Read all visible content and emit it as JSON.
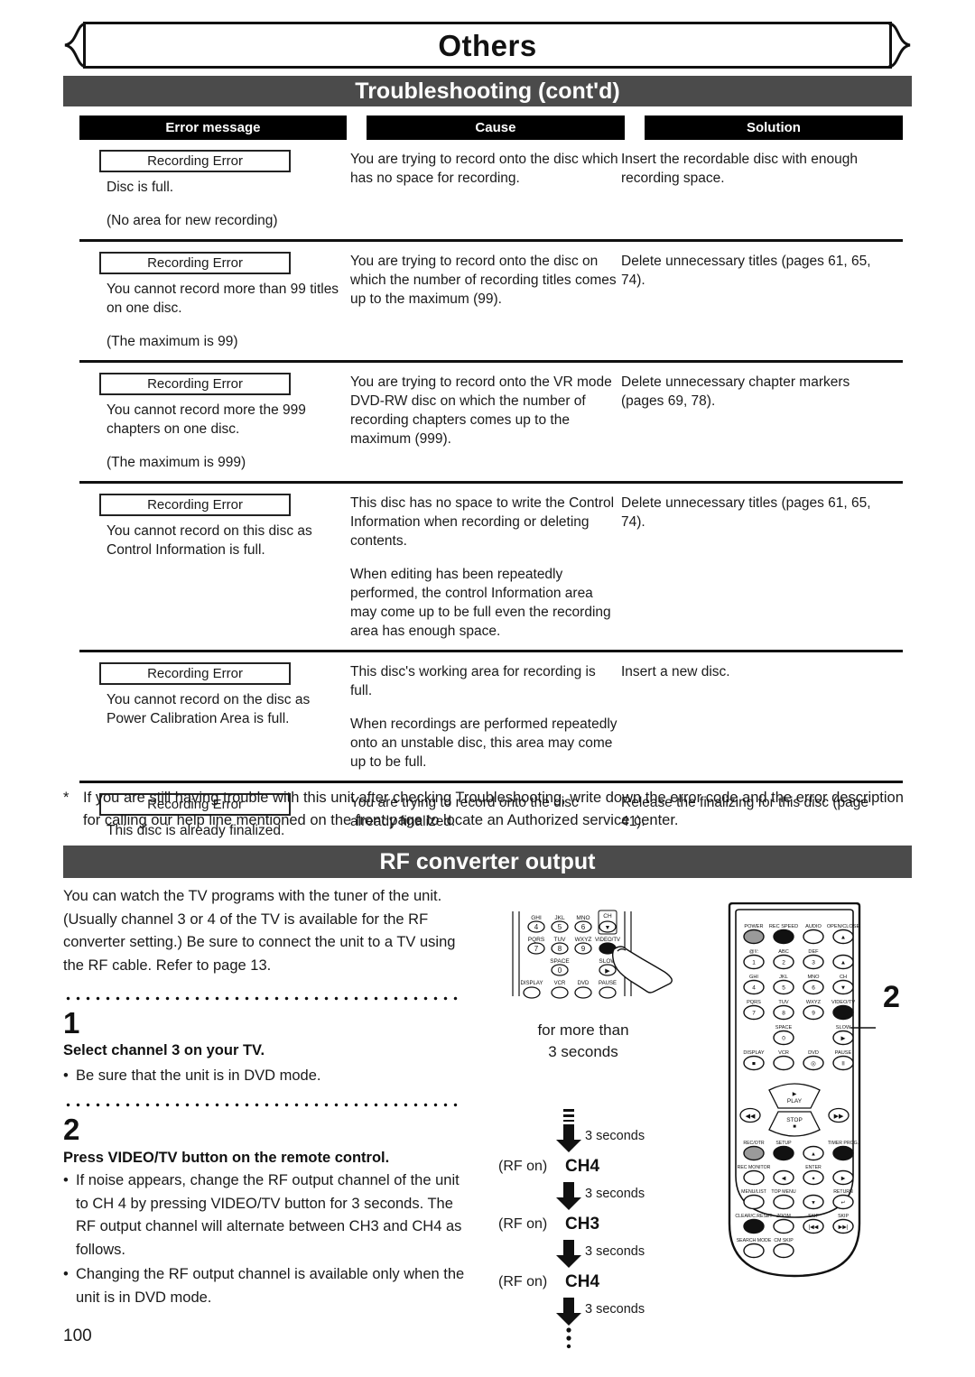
{
  "chapter": {
    "title": "Others"
  },
  "sections": {
    "troubleshooting": {
      "title": "Troubleshooting (cont'd)"
    },
    "rf": {
      "title": "RF converter output"
    }
  },
  "table": {
    "headers": {
      "error": "Error message",
      "cause": "Cause",
      "solution": "Solution"
    },
    "rows": [
      {
        "badge": "Recording Error",
        "error_lines": [
          "Disc is full.",
          "(No area for new recording)"
        ],
        "cause_lines": [
          "You are trying to record onto the disc which has no space for recording."
        ],
        "solution_lines": [
          "Insert the recordable disc with enough recording space."
        ]
      },
      {
        "badge": "Recording Error",
        "error_lines": [
          "You cannot record more than 99 titles on one disc.",
          "(The maximum is 99)"
        ],
        "cause_lines": [
          "You are trying to record onto the disc on which the number of recording titles comes up to the maximum (99)."
        ],
        "solution_lines": [
          "Delete unnecessary titles (pages 61, 65, 74)."
        ]
      },
      {
        "badge": "Recording Error",
        "error_lines": [
          "You cannot record more the 999 chapters on one disc.",
          "(The maximum is 999)"
        ],
        "cause_lines": [
          "You are trying to record onto the VR mode DVD-RW disc on which the number of recording chapters comes up to the maximum (999)."
        ],
        "solution_lines": [
          "Delete unnecessary chapter markers (pages 69, 78)."
        ]
      },
      {
        "badge": "Recording Error",
        "error_lines": [
          "You cannot record on this disc as Control Information is full."
        ],
        "cause_lines": [
          "This disc has no space to write the Control Information when recording or deleting contents.",
          "When editing has been repeatedly performed, the control Information area may come up to be full even the recording area has enough space."
        ],
        "solution_lines": [
          "Delete unnecessary titles (pages 61, 65, 74)."
        ]
      },
      {
        "badge": "Recording Error",
        "error_lines": [
          "You cannot record on the disc as Power Calibration Area is full."
        ],
        "cause_lines": [
          "This disc's working area for recording is full.",
          "When recordings are performed repeatedly onto an unstable disc, this area may come up to be full."
        ],
        "solution_lines": [
          "Insert a new disc."
        ]
      },
      {
        "badge": "Recording Error",
        "error_lines": [
          "This disc is already finalized."
        ],
        "cause_lines": [
          "You are trying to record onto the disc already finalized."
        ],
        "solution_lines": [
          "Release the finalizing for this disc (page 41)."
        ]
      }
    ]
  },
  "footnote": {
    "marker": "*",
    "text": "If you are still having trouble with this unit after checking Troubleshooting, write down the error code and the error description for calling our help line mentioned on the front page to locate an Authorized service center."
  },
  "rf_section": {
    "intro": "You can watch the TV programs with the tuner of the unit. (Usually channel 3 or 4 of the TV is available for the RF converter setting.) Be sure to connect the unit to a TV using the RF cable. Refer to page 13.",
    "steps": [
      {
        "number": "1",
        "heading": "Select channel 3 on your TV.",
        "bullets": [
          "Be sure that the unit is in DVD mode."
        ]
      },
      {
        "number": "2",
        "heading": "Press VIDEO/TV button on the remote control.",
        "bullets": [
          "If noise appears, change the RF output channel of the unit to CH 4 by pressing VIDEO/TV button for 3 seconds. The RF output channel will alternate between CH3 and CH4 as follows.",
          "Changing the RF output channel is available only when the unit is in DVD mode."
        ],
        "bullet_dot": "•"
      }
    ],
    "press_caption": {
      "line1": "for more than",
      "line2": "3 seconds"
    },
    "callout_number": "2",
    "flow": {
      "duration_label": "3 seconds",
      "rf_on_label": "(RF on)",
      "states": [
        "CH4",
        "CH3",
        "CH4"
      ]
    }
  },
  "keypad_closeup": {
    "keys": [
      {
        "label": "GHI",
        "digit": "4"
      },
      {
        "label": "JKL",
        "digit": "5"
      },
      {
        "label": "MNO",
        "digit": "6"
      },
      {
        "label": "CH",
        "digit": "▼"
      },
      {
        "label": "PQRS",
        "digit": "7"
      },
      {
        "label": "TUV",
        "digit": "8"
      },
      {
        "label": "WXYZ",
        "digit": "9"
      },
      {
        "label": "VIDEO/TV",
        "digit": ""
      },
      {
        "label": "SPACE",
        "digit": "0"
      },
      {
        "label": "SLOW",
        "digit": "▶"
      },
      {
        "label": "DISPLAY",
        "digit": "■"
      },
      {
        "label": "VCR",
        "digit": ""
      },
      {
        "label": "DVD",
        "digit": ""
      },
      {
        "label": "PAUSE",
        "digit": "II"
      }
    ]
  },
  "remote": {
    "rows": [
      [
        {
          "l": "POWER",
          "g": ""
        },
        {
          "l": "REC SPEED",
          "g": ""
        },
        {
          "l": "AUDIO",
          "g": ""
        },
        {
          "l": "OPEN/CLOSE",
          "g": "▲"
        }
      ],
      [
        {
          "l": "@!/:",
          "g": "1"
        },
        {
          "l": "ABC",
          "g": "2"
        },
        {
          "l": "DEF",
          "g": "3"
        },
        {
          "l": "",
          "g": "▲"
        }
      ],
      [
        {
          "l": "GHI",
          "g": "4"
        },
        {
          "l": "JKL",
          "g": "5"
        },
        {
          "l": "MNO",
          "g": "6"
        },
        {
          "l": "CH",
          "g": "▼"
        }
      ],
      [
        {
          "l": "PQRS",
          "g": "7"
        },
        {
          "l": "TUV",
          "g": "8"
        },
        {
          "l": "WXYZ",
          "g": "9"
        },
        {
          "l": "VIDEO/TV",
          "g": ""
        }
      ],
      [
        {
          "l": "",
          "g": ""
        },
        {
          "l": "SPACE",
          "g": "0"
        },
        {
          "l": "",
          "g": ""
        },
        {
          "l": "SLOW",
          "g": "▶"
        }
      ],
      [
        {
          "l": "DISPLAY",
          "g": "■"
        },
        {
          "l": "VCR",
          "g": ""
        },
        {
          "l": "DVD",
          "g": "◎"
        },
        {
          "l": "PAUSE",
          "g": "II"
        }
      ]
    ],
    "transport": {
      "play": "PLAY",
      "stop": "STOP",
      "rew": "◀◀",
      "ffwd": "▶▶"
    },
    "lower_rows": [
      [
        {
          "l": "REC/OTR",
          "g": ""
        },
        {
          "l": "SETUP",
          "g": ""
        },
        {
          "l": "",
          "g": "▲"
        },
        {
          "l": "TIMER PROG.",
          "g": ""
        }
      ],
      [
        {
          "l": "REC MONITOR",
          "g": ""
        },
        {
          "l": "",
          "g": "◀"
        },
        {
          "l": "ENTER",
          "g": "●"
        },
        {
          "l": "",
          "g": "▶"
        }
      ],
      [
        {
          "l": "MENU/LIST",
          "g": ""
        },
        {
          "l": "TOP MENU",
          "g": ""
        },
        {
          "l": "",
          "g": "▼"
        },
        {
          "l": "RETURN",
          "g": "↵"
        }
      ],
      [
        {
          "l": "CLEAR/C.RESET",
          "g": ""
        },
        {
          "l": "ZOOM",
          "g": ""
        },
        {
          "l": "SKIP",
          "g": "|◀◀"
        },
        {
          "l": "SKIP",
          "g": "▶▶|"
        }
      ],
      [
        {
          "l": "SEARCH MODE",
          "g": ""
        },
        {
          "l": "CM SKIP",
          "g": ""
        },
        {
          "l": "",
          "g": ""
        },
        {
          "l": "",
          "g": ""
        }
      ]
    ]
  },
  "page": {
    "number": "100"
  }
}
